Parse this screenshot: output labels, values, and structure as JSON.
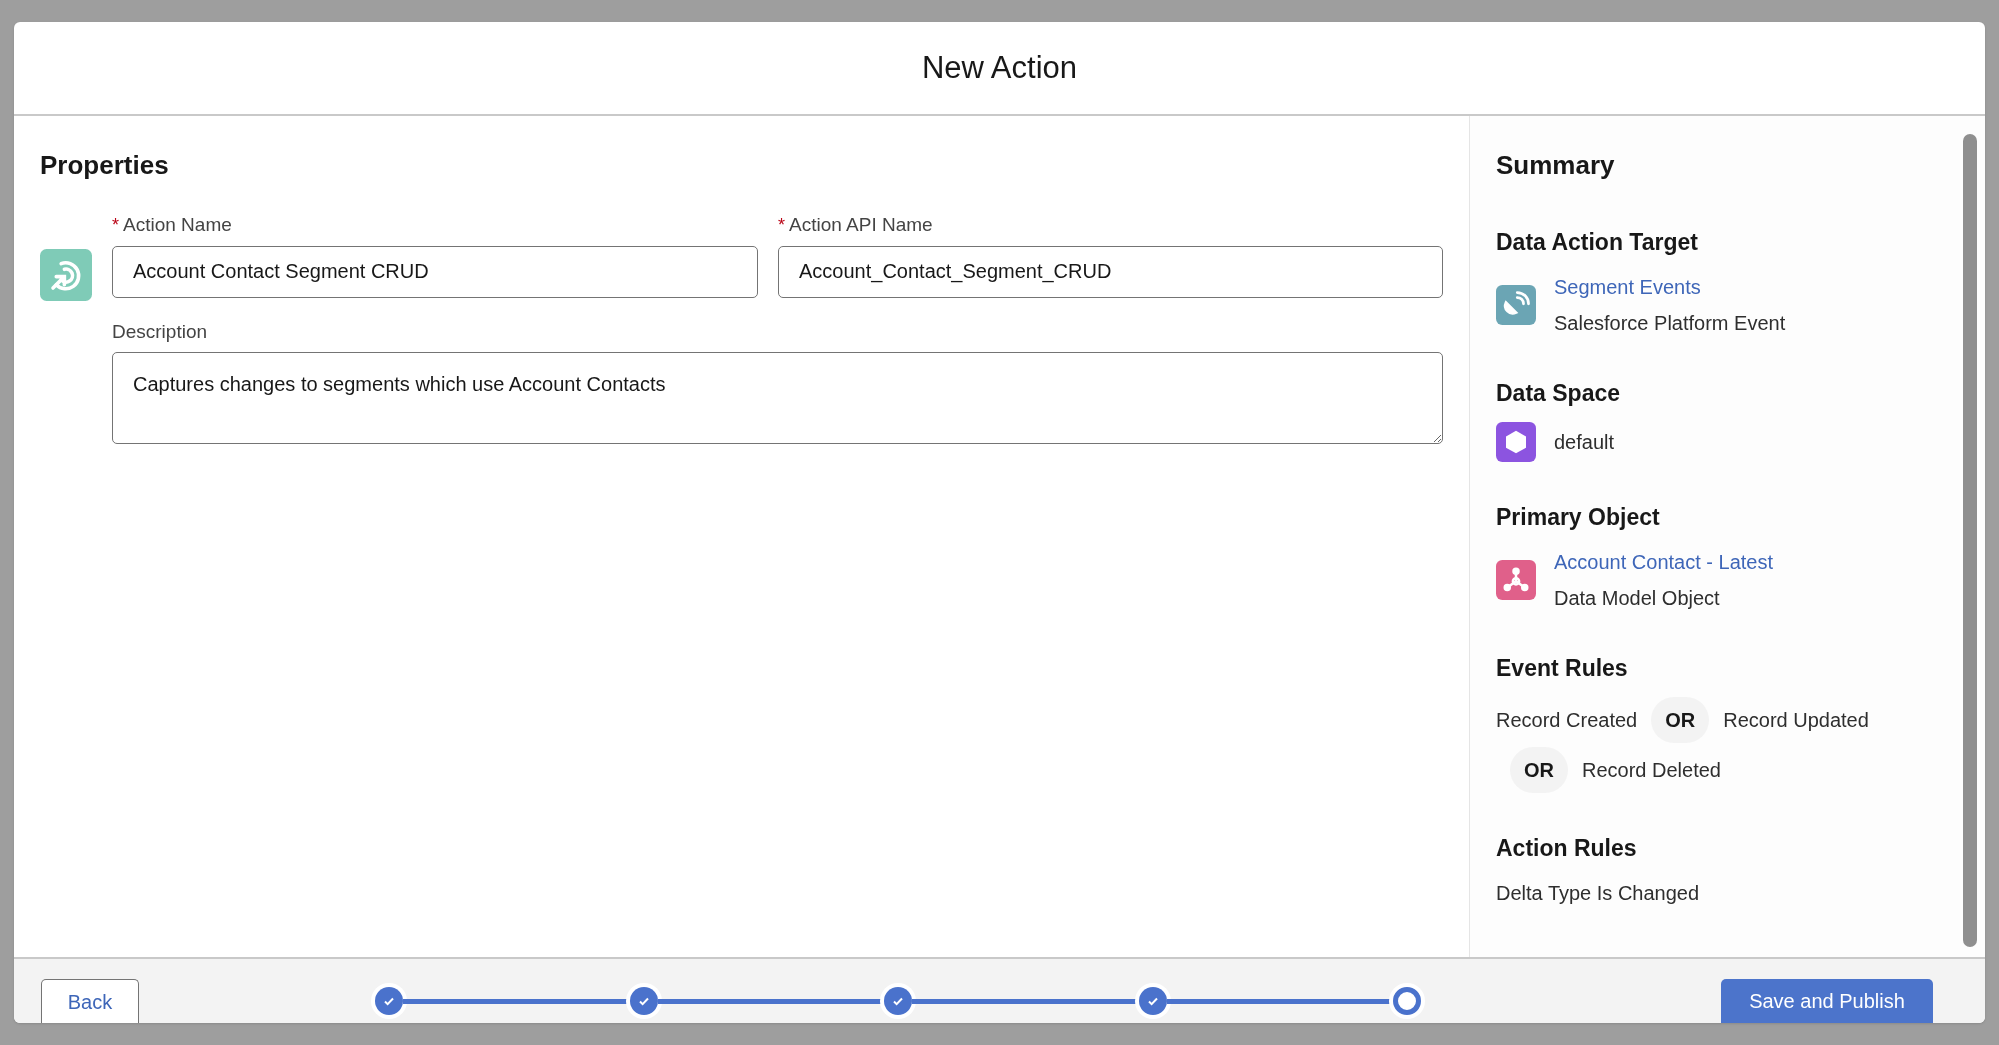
{
  "modal": {
    "title": "New Action"
  },
  "properties": {
    "heading": "Properties",
    "fields": [
      {
        "label": "Action Name",
        "required_mark": "*",
        "value": "Account Contact Segment CRUD"
      },
      {
        "label": "Action API Name",
        "required_mark": "*",
        "value": "Account_Contact_Segment_CRUD"
      }
    ],
    "description": {
      "label": "Description",
      "value": "Captures changes to segments which use Account Contacts"
    }
  },
  "summary": {
    "heading": "Summary",
    "sections": [
      {
        "kind": "item",
        "heading": "Data Action Target",
        "color": "#6ba5b4",
        "link": "Segment Events",
        "subtitle": "Salesforce Platform Event"
      },
      {
        "kind": "item",
        "heading": "Data Space",
        "color": "#8c54e0",
        "text": "default"
      },
      {
        "kind": "item",
        "heading": "Primary Object",
        "color": "#e0608a",
        "link": "Account Contact - Latest",
        "subtitle": "Data Model Object"
      },
      {
        "kind": "rules",
        "heading": "Event Rules",
        "rules": [
          {
            "text": "Record Created"
          },
          {
            "operator": "OR",
            "text": "Record Updated"
          },
          {
            "operator": "OR",
            "text": "Record Deleted"
          }
        ]
      },
      {
        "kind": "text",
        "heading": "Action Rules",
        "text": "Delta Type Is Changed"
      }
    ]
  },
  "footer": {
    "back": "Back",
    "primary": "Save and Publish",
    "steps": [
      {
        "completed": true
      },
      {
        "completed": true
      },
      {
        "completed": true
      },
      {
        "completed": true
      },
      {
        "completed": false
      }
    ]
  }
}
